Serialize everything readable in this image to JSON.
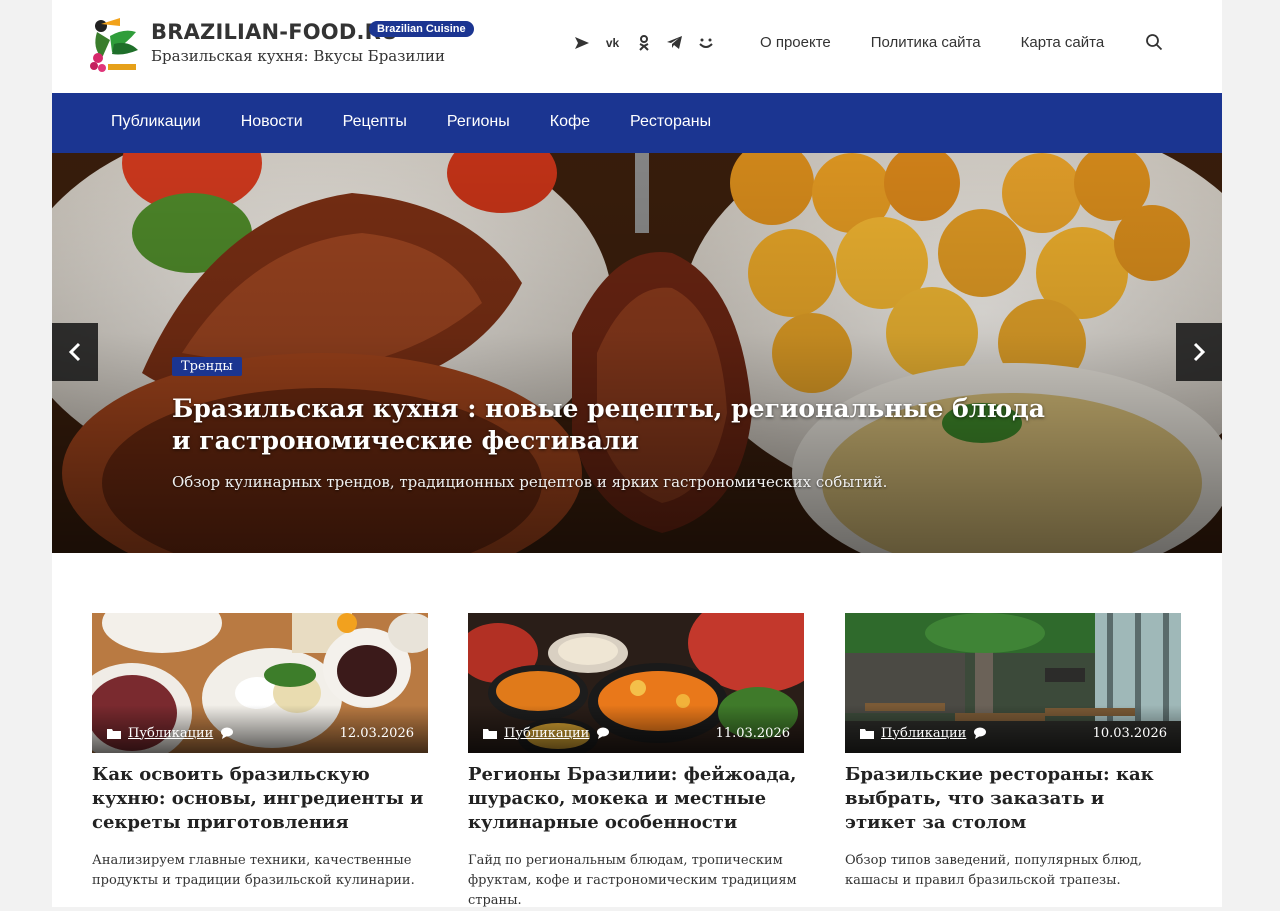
{
  "site": {
    "name": "BRAZILIAN-FOOD.RU",
    "badge": "Brazilian Cuisine",
    "tagline": "Бразильская кухня: Вкусы Бразилии"
  },
  "socials": [
    "telegram-send-icon",
    "vk-icon",
    "odnoklassniki-icon",
    "telegram-icon",
    "smile-icon"
  ],
  "top_nav": [
    "О проекте",
    "Политика сайта",
    "Карта сайта"
  ],
  "main_nav": [
    "Публикации",
    "Новости",
    "Рецепты",
    "Регионы",
    "Кофе",
    "Рестораны"
  ],
  "hero": {
    "tag": "Тренды",
    "title": "Бразильская кухня : новые рецепты, региональные блюда и гастрономические фестивали",
    "description": "Обзор кулинарных трендов, традиционных рецептов и ярких гастрономических событий."
  },
  "cards": [
    {
      "category": "Публикации",
      "date": "12.03.2026",
      "title": "Как освоить бразильскую кухню: основы, ингредиенты и секреты приготовления",
      "excerpt": "Анализируем главные техники, качественные продукты и традиции бразильской кулинарии."
    },
    {
      "category": "Публикации",
      "date": "11.03.2026",
      "title": "Регионы Бразилии: фейжоада, шураско, мокека и местные кулинарные особенности",
      "excerpt": "Гайд по региональным блюдам, тропическим фруктам, кофе и гастрономическим традициям страны."
    },
    {
      "category": "Публикации",
      "date": "10.03.2026",
      "title": "Бразильские рестораны: как выбрать, что заказать и этикет за столом",
      "excerpt": "Обзор типов заведений, популярных блюд, кашасы и правил бразильской трапезы."
    }
  ],
  "colors": {
    "brand_blue": "#1b3591",
    "page_bg": "#f2f2f2"
  }
}
